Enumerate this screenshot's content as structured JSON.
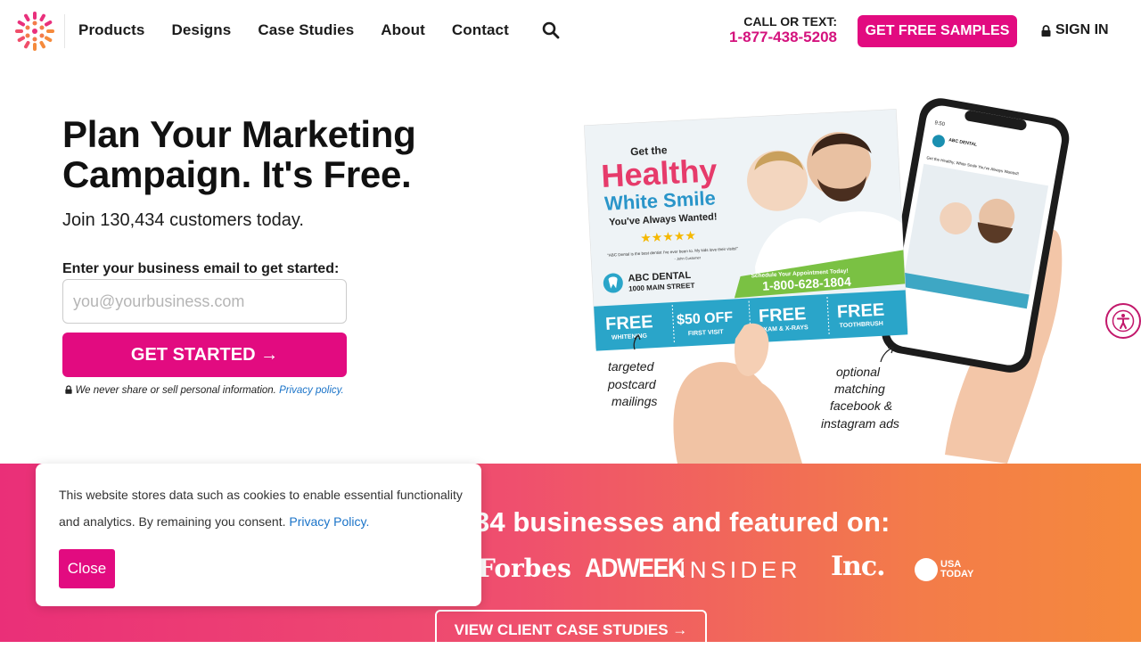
{
  "brand": {
    "accent": "#e20b80",
    "link": "#1a73c8"
  },
  "nav": {
    "items": [
      "Products",
      "Designs",
      "Case Studies",
      "About",
      "Contact"
    ],
    "search_icon": "search-icon"
  },
  "contact": {
    "label": "CALL OR TEXT:",
    "phone": "1-877-438-5208"
  },
  "header": {
    "samples_label": "GET FREE SAMPLES",
    "signin_label": "SIGN IN"
  },
  "hero": {
    "title_line1": "Plan Your Marketing",
    "title_line2": "Campaign. It's Free.",
    "subtitle": "Join 130,434 customers today.",
    "email_label": "Enter your business email to get started:",
    "email_placeholder": "you@yourbusiness.com",
    "cta_label": "GET STARTED →",
    "privacy_text": "We never share or sell personal information.",
    "privacy_link": "Privacy policy."
  },
  "visual": {
    "postcard_get": "Get the",
    "postcard_healthy": "Healthy",
    "postcard_white": "White Smile",
    "postcard_wanted": "You've Always Wanted!",
    "postcard_quote": "\"ABC Dental is the best dentist I've ever been to. My kids love their visits!\"",
    "postcard_quote_author": "- John Customer",
    "postcard_business": "ABC DENTAL",
    "postcard_address": "1000 MAIN STREET",
    "postcard_schedule": "Schedule Your Appointment Today!",
    "postcard_phone": "1-800-628-1804",
    "offers": [
      {
        "big": "FREE",
        "small": "WHITENING"
      },
      {
        "big": "$50 OFF",
        "small": "FIRST VISIT"
      },
      {
        "big": "FREE",
        "small": "EXAM & X-RAYS"
      },
      {
        "big": "FREE",
        "small": "TOOTHBRUSH"
      }
    ],
    "note_postcard": [
      "targeted",
      "postcard",
      "mailings"
    ],
    "note_ads": [
      "optional",
      "matching",
      "facebook &",
      "instagram ads"
    ],
    "phone_time": "9:50",
    "phone_page": "ABC DENTAL",
    "phone_post": "Get the Healthy, White Smile You've Always Wanted!"
  },
  "band": {
    "title": "34 businesses and featured on:",
    "press": [
      "Forbes",
      "ADWEEK",
      "INSIDER",
      "Inc.",
      "USA TODAY"
    ],
    "case_label": "VIEW CLIENT CASE STUDIES →"
  },
  "cookie": {
    "text": "This website stores data such as cookies to enable essential functionality and analytics. By remaining you consent.",
    "link": "Privacy Policy.",
    "close_label": "Close"
  }
}
